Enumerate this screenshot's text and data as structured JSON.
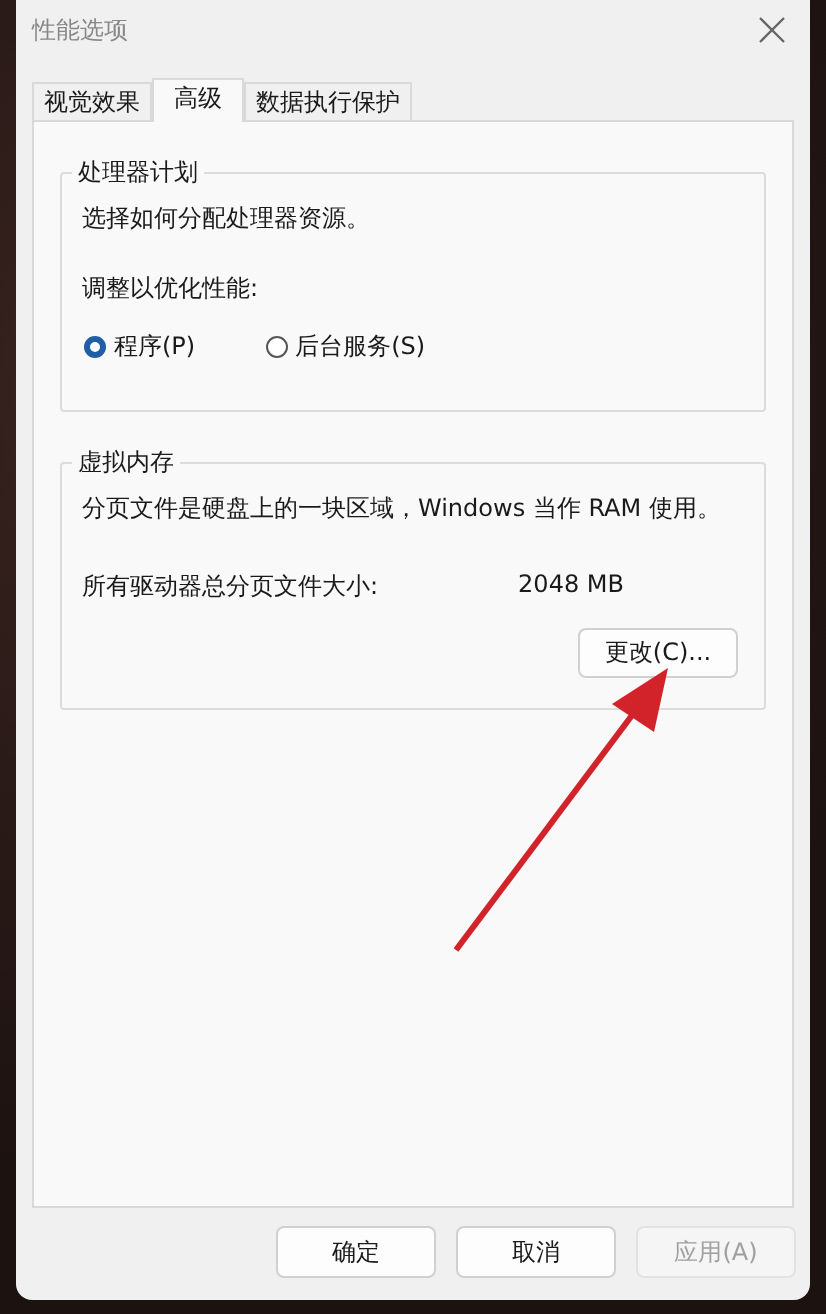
{
  "window": {
    "title": "性能选项"
  },
  "tabs": [
    {
      "label": "视觉效果",
      "selected": false
    },
    {
      "label": "高级",
      "selected": true
    },
    {
      "label": "数据执行保护",
      "selected": false
    }
  ],
  "processor_group": {
    "title": "处理器计划",
    "description": "选择如何分配处理器资源。",
    "prompt": "调整以优化性能:",
    "options": [
      {
        "label": "程序(P)",
        "selected": true
      },
      {
        "label": "后台服务(S)",
        "selected": false
      }
    ]
  },
  "memory_group": {
    "title": "虚拟内存",
    "description": "分页文件是硬盘上的一块区域，Windows 当作 RAM 使用。",
    "size_label": "所有驱动器总分页文件大小:",
    "size_value": "2048 MB",
    "change_button": "更改(C)..."
  },
  "buttons": [
    {
      "label": "确定",
      "disabled": false
    },
    {
      "label": "取消",
      "disabled": false
    },
    {
      "label": "应用(A)",
      "disabled": true
    }
  ]
}
